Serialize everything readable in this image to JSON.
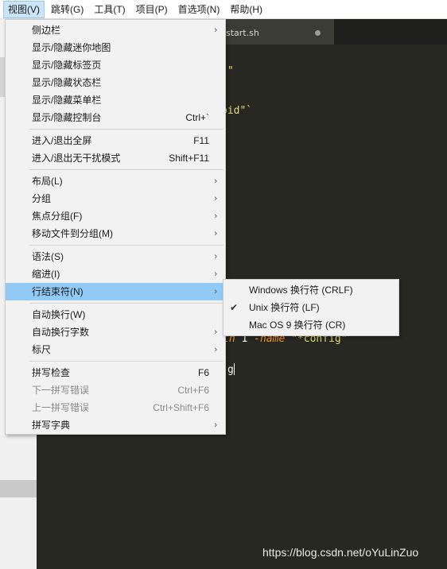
{
  "menubar": [
    {
      "label": "视图(V)",
      "active": true
    },
    {
      "label": "跳转(G)"
    },
    {
      "label": "工具(T)"
    },
    {
      "label": "项目(P)"
    },
    {
      "label": "首选项(N)"
    },
    {
      "label": "帮助(H)"
    }
  ],
  "editor": {
    "tab_title": "start.sh",
    "code": {
      "line1": "\"",
      "line2": "pid\"`",
      "line3_kw1": "th",
      "line3_plain": " 1 ",
      "line3_kw2": "-name",
      "line3_str": " \"*config\"",
      "line4": "g"
    }
  },
  "view_menu": {
    "sidebar": "侧边栏",
    "minimap": "显示/隐藏迷你地图",
    "tabs": "显示/隐藏标签页",
    "statusbar": "显示/隐藏状态栏",
    "menubar": "显示/隐藏菜单栏",
    "console": "显示/隐藏控制台",
    "console_shortcut": "Ctrl+`",
    "fullscreen": "进入/退出全屏",
    "fullscreen_shortcut": "F11",
    "distraction_free": "进入/退出无干扰模式",
    "distraction_free_shortcut": "Shift+F11",
    "layout": "布局(L)",
    "groups": "分组",
    "focus_group": "焦点分组(F)",
    "move_to_group": "移动文件到分组(M)",
    "syntax": "语法(S)",
    "indentation": "缩进(I)",
    "line_endings": "行结束符(N)",
    "word_wrap": "自动换行(W)",
    "word_wrap_column": "自动换行字数",
    "ruler": "标尺",
    "spell_check": "拼写检查",
    "spell_check_shortcut": "F6",
    "next_misspelling": "下一拼写错误",
    "next_misspelling_shortcut": "Ctrl+F6",
    "prev_misspelling": "上一拼写错误",
    "prev_misspelling_shortcut": "Ctrl+Shift+F6",
    "dictionary": "拼写字典"
  },
  "line_endings_menu": {
    "windows": "Windows 换行符 (CRLF)",
    "unix": "Unix 换行符 (LF)",
    "mac": "Mac OS 9 换行符 (CR)",
    "selected": "unix",
    "check_glyph": "✔"
  },
  "watermark": "https://blog.csdn.net/oYuLinZuo",
  "arrow_glyph": "›",
  "colors": {
    "editor_bg": "#272822",
    "highlight": "#91c9f7",
    "string": "#e6db74",
    "keyword": "#fd971f"
  }
}
